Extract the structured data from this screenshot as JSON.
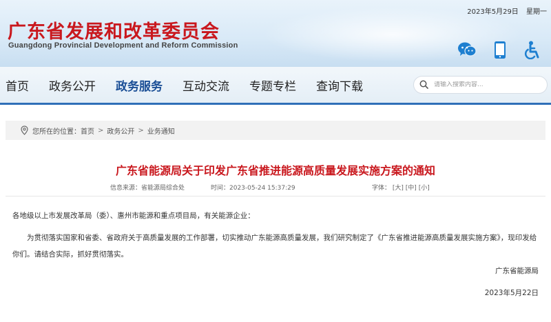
{
  "header": {
    "date": "2023年5月29日",
    "weekday": "星期一",
    "title": "广东省发展和改革委员会",
    "subtitle": "Guangdong Provincial Development and Reform Commission",
    "icons": [
      "wechat-icon",
      "mobile-icon",
      "accessibility-icon"
    ]
  },
  "nav": {
    "items": [
      {
        "label": "首页"
      },
      {
        "label": "政务公开"
      },
      {
        "label": "政务服务"
      },
      {
        "label": "互动交流"
      },
      {
        "label": "专题专栏"
      },
      {
        "label": "查询下载"
      }
    ],
    "active_index": 2
  },
  "search": {
    "placeholder": "请输入搜索内容..."
  },
  "breadcrumb": {
    "prefix": "您所在的位置：",
    "items": [
      "首页",
      "政务公开",
      "业务通知"
    ],
    "separator": ">"
  },
  "article": {
    "title": "广东省能源局关于印发广东省推进能源高质量发展实施方案的通知",
    "source": "信息来源：省能源局综合处",
    "time": "时间：2023-05-24 15:37:29",
    "font_label": "字体：",
    "font_sizes": [
      "[大]",
      "[中]",
      "[小]"
    ],
    "salutation": "各地级以上市发展改革局（委）、惠州市能源和重点项目局，有关能源企业：",
    "body": "为贯彻落实国家和省委、省政府关于高质量发展的工作部署，切实推动广东能源高质量发展，我们研究制定了《广东省推进能源高质量发展实施方案》，现印发给你们。请结合实际，抓好贯彻落实。",
    "signer": "广东省能源局",
    "sign_date": "2023年5月22日"
  },
  "colors": {
    "brand_red": "#c9181e",
    "nav_active": "#1b4f96",
    "nav_border": "#2f6fb8",
    "icon_blue": "#1e7fd0"
  }
}
